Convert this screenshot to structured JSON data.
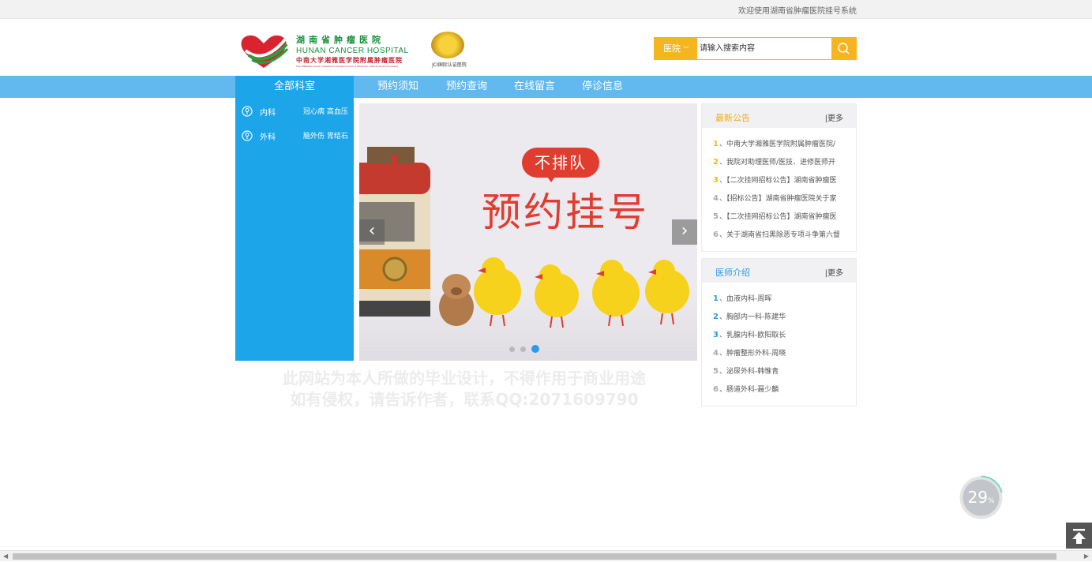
{
  "topbar": {
    "welcome": "欢迎使用湖南省肿瘤医院挂号系统"
  },
  "logo": {
    "cn": "湖南省肿瘤医院",
    "en": "HUNAN CANCER HOSPITAL",
    "sub": "中南大学湘雅医学院附属肿瘤医院",
    "tiny": "The Affiliated Cancer Hospital of Xiangya School of Medicine, Central South University",
    "jci": "JCI国际认证医院"
  },
  "search": {
    "type": "医院",
    "placeholder": "请输入搜索内容"
  },
  "nav": {
    "all_departments": "全部科室",
    "items": [
      "预约须知",
      "预约查询",
      "在线留言",
      "停诊信息"
    ]
  },
  "departments": [
    {
      "name": "内科",
      "subs": "冠心病 高血压"
    },
    {
      "name": "外科",
      "subs": "脑外伤 胃结石"
    }
  ],
  "banner": {
    "bubble": "不排队",
    "headline": "预约挂号",
    "prev": "‹",
    "next": "›",
    "slide_count": 3,
    "active_slide": 3
  },
  "watermark": {
    "line1": "此网站为本人所做的毕业设计，不得作用于商业用途",
    "line2": "如有侵权，请告诉作者，联系QQ:2071609790"
  },
  "notices": {
    "title": "最新公告",
    "more": "|更多",
    "items": [
      "中南大学湘雅医学院附属肿瘤医院/",
      "我院对助理医师/医技、进修医师开",
      "【二次挂网招标公告】湖南省肿瘤医",
      "【招标公告】湖南省肿瘤医院关于家",
      "【二次挂网招标公告】湖南省肿瘤医",
      "关于湖南省扫黑除恶专项斗争第六督"
    ]
  },
  "doctors": {
    "title": "医师介绍",
    "more": "|更多",
    "items": [
      "血液内科-周晖",
      "胸部内一科-陈建华",
      "乳腺内科-欧阳取长",
      "肿瘤整形外科-周晓",
      "泌尿外科-韩惟青",
      "肠道外科-聂少麟"
    ]
  },
  "progress": {
    "value": "29",
    "unit": "%"
  },
  "colors": {
    "accent": "#1da5ea",
    "nav_bar": "#61b9ef",
    "search_orange": "#f5b520",
    "headline_red": "#e03c2f",
    "notice_title": "#f5a623",
    "doctor_title": "#2d9ae8"
  },
  "icons": {
    "search": "search-icon",
    "dept": "location-pin-icon",
    "backtop": "back-to-top-icon"
  }
}
